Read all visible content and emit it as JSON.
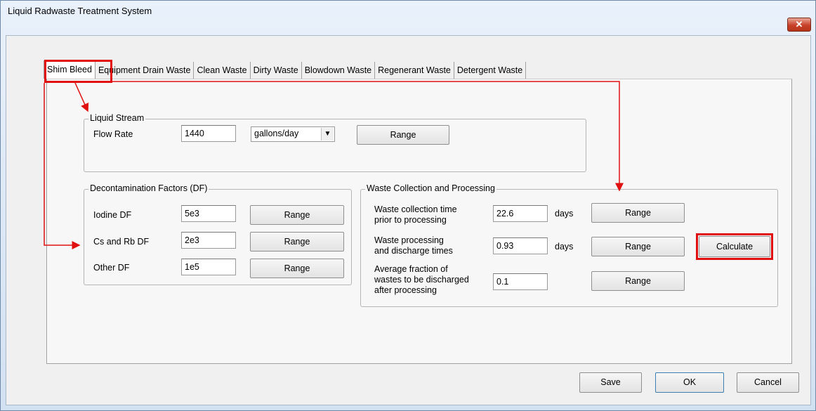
{
  "window": {
    "title": "Liquid Radwaste Treatment System",
    "close_label": "✕"
  },
  "tabs": [
    {
      "label": "Shim Bleed"
    },
    {
      "label": "Equipment Drain Waste"
    },
    {
      "label": "Clean Waste"
    },
    {
      "label": "Dirty Waste"
    },
    {
      "label": "Blowdown Waste"
    },
    {
      "label": "Regenerant Waste"
    },
    {
      "label": "Detergent Waste"
    }
  ],
  "liquid_stream": {
    "title": "Liquid Stream",
    "flow_rate_label": "Flow Rate",
    "flow_rate_value": "1440",
    "units_selected": "gallons/day",
    "range_label": "Range"
  },
  "df": {
    "title": "Decontamination Factors (DF)",
    "rows": [
      {
        "label": "Iodine DF",
        "value": "5e3",
        "button": "Range"
      },
      {
        "label": "Cs and Rb DF",
        "value": "2e3",
        "button": "Range"
      },
      {
        "label": "Other  DF",
        "value": "1e5",
        "button": "Range"
      }
    ]
  },
  "waste": {
    "title": "Waste Collection and Processing",
    "rows": [
      {
        "line1": "Waste collection time",
        "line2": "prior to processing",
        "line3": "",
        "value": "22.6",
        "unit": "days",
        "button": "Range"
      },
      {
        "line1": "Waste processing",
        "line2": "and discharge times",
        "line3": "",
        "value": "0.93",
        "unit": "days",
        "button": "Range"
      },
      {
        "line1": "Average fraction of",
        "line2": "wastes to be discharged",
        "line3": "after processing",
        "value": "0.1",
        "unit": "",
        "button": "Range"
      }
    ],
    "calculate_label": "Calculate"
  },
  "footer": {
    "save_label": "Save",
    "ok_label": "OK",
    "cancel_label": "Cancel"
  },
  "colors": {
    "highlight": "#e01010",
    "titlebar": "#dbe7f5"
  }
}
